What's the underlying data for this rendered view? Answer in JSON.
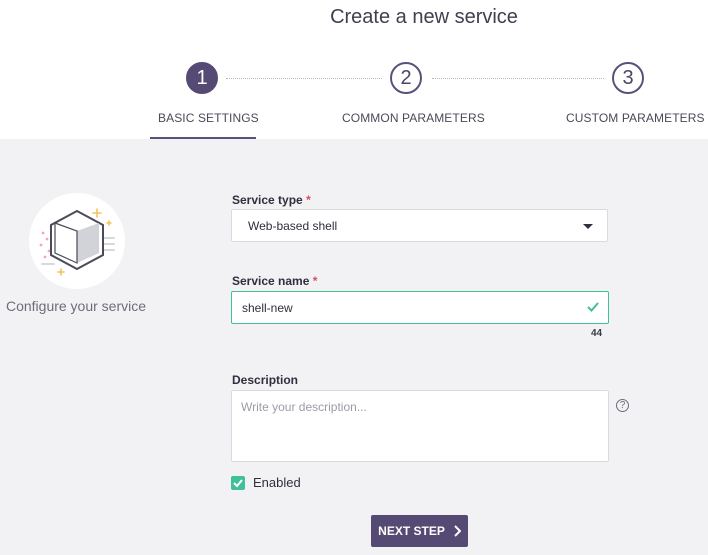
{
  "page": {
    "title": "Create a new service"
  },
  "steps": [
    {
      "number": "1",
      "label": "BASIC SETTINGS",
      "active": true
    },
    {
      "number": "2",
      "label": "COMMON PARAMETERS",
      "active": false
    },
    {
      "number": "3",
      "label": "CUSTOM PARAMETERS",
      "active": false
    }
  ],
  "sidebar": {
    "caption": "Configure your service",
    "illustration": "hexagon-box-icon"
  },
  "form": {
    "service_type": {
      "label": "Service type",
      "required_mark": "*",
      "value": "Web-based shell"
    },
    "service_name": {
      "label": "Service name",
      "required_mark": "*",
      "value": "shell-new",
      "remaining_chars": "44"
    },
    "description": {
      "label": "Description",
      "placeholder": "Write your description...",
      "help_icon": "?"
    },
    "enabled": {
      "label": "Enabled",
      "checked": true
    }
  },
  "actions": {
    "next_label": "NEXT STEP"
  },
  "colors": {
    "accent": "#554a73",
    "success": "#3fbf9a",
    "required": "#d94b5a",
    "background": "#f2f2f5"
  }
}
